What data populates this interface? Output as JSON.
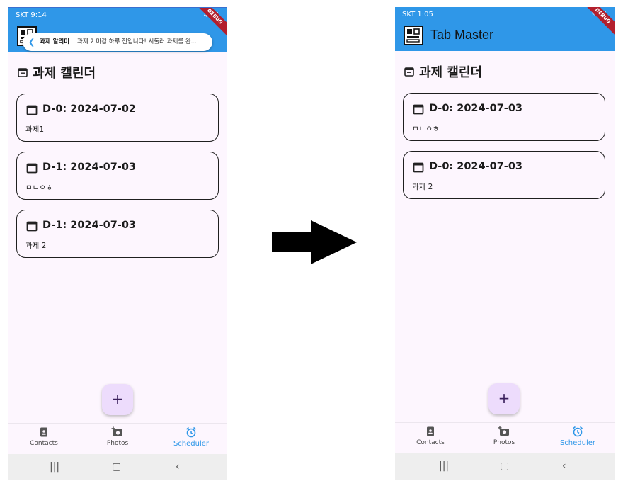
{
  "colors": {
    "accent": "#2f97e8",
    "fab_bg": "#eddcfc",
    "page_bg": "#fdf6fe",
    "ribbon": "#b21f2d"
  },
  "before": {
    "status": {
      "left": "SKT 9:14",
      "right": "41%"
    },
    "debug_ribbon": "DEBUG",
    "notification": {
      "title": "과제 알리미",
      "message": "과제 2 마감 하루 전입니다! 서둘러 과제를 완..."
    },
    "page_title": "과제 캘린더",
    "cards": [
      {
        "date": "D-0: 2024-07-02",
        "text": "과제1"
      },
      {
        "date": "D-1: 2024-07-03",
        "text": "ㅁㄴㅇㅎ"
      },
      {
        "date": "D-1: 2024-07-03",
        "text": "과제 2"
      }
    ],
    "fab": "+",
    "nav": {
      "contacts": "Contacts",
      "photos": "Photos",
      "scheduler": "Scheduler",
      "active": "scheduler"
    }
  },
  "after": {
    "status": {
      "left": "SKT 1:05",
      "right": "92%"
    },
    "debug_ribbon": "DEBUG",
    "app_title": "Tab Master",
    "page_title": "과제 캘린더",
    "cards": [
      {
        "date": "D-0: 2024-07-03",
        "text": "ㅁㄴㅇㅎ"
      },
      {
        "date": "D-0: 2024-07-03",
        "text": "과제 2"
      }
    ],
    "fab": "+",
    "nav": {
      "contacts": "Contacts",
      "photos": "Photos",
      "scheduler": "Scheduler",
      "active": "scheduler"
    }
  },
  "icons": {
    "app_logo": "app-logo-icon",
    "calendar": "calendar-icon",
    "contacts": "contact-card-icon",
    "photos": "camera-add-icon",
    "scheduler": "alarm-clock-icon",
    "arrow": "right-arrow-icon"
  }
}
